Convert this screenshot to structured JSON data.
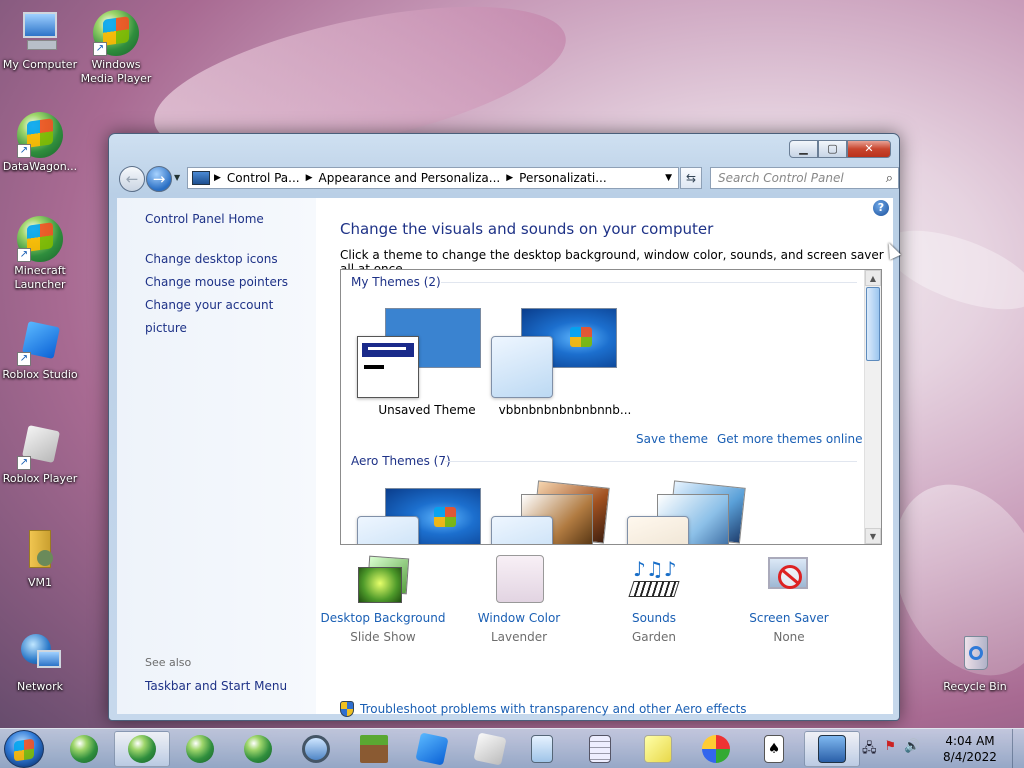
{
  "desktop": {
    "icons": [
      {
        "label": "My Computer",
        "icon": "computer-icon"
      },
      {
        "label": "Windows Media Player",
        "icon": "media-player-icon"
      },
      {
        "label": "DataWagon...",
        "icon": "shortcut-orb-icon"
      },
      {
        "label": "Minecraft Launcher",
        "icon": "shortcut-orb-icon"
      },
      {
        "label": "Roblox Studio",
        "icon": "roblox-studio-icon"
      },
      {
        "label": "Roblox Player",
        "icon": "roblox-player-icon"
      },
      {
        "label": "VM1",
        "icon": "user-folder-icon"
      },
      {
        "label": "Network",
        "icon": "network-icon"
      },
      {
        "label": "Recycle Bin",
        "icon": "recycle-bin-icon"
      }
    ]
  },
  "window": {
    "caption_buttons": {
      "minimize": "▁",
      "maximize": "▢",
      "close": "✕"
    },
    "breadcrumb": [
      "Control Pa...",
      "Appearance and Personaliza...",
      "Personalizati..."
    ],
    "search_placeholder": "Search Control Panel",
    "left_pane": {
      "home": "Control Panel Home",
      "tasks": [
        "Change desktop icons",
        "Change mouse pointers",
        "Change your account picture"
      ],
      "see_also": "See also",
      "see_also_links": [
        "Taskbar and Start Menu"
      ]
    },
    "content": {
      "title": "Change the visuals and sounds on your computer",
      "subtitle": "Click a theme to change the desktop background, window color, sounds, and screen saver all at once.",
      "my_themes_label": "My Themes (2)",
      "my_themes": [
        {
          "name": "Unsaved Theme"
        },
        {
          "name": "vbbnbnbnbnbnbnnb..."
        }
      ],
      "save_theme": "Save theme",
      "get_more": "Get more themes online",
      "aero_themes_label": "Aero Themes (7)",
      "bottom_items": [
        {
          "label": "Desktop Background",
          "value": "Slide Show",
          "icon": "desktop-background-icon"
        },
        {
          "label": "Window Color",
          "value": "Lavender",
          "icon": "window-color-icon"
        },
        {
          "label": "Sounds",
          "value": "Garden",
          "icon": "sounds-icon"
        },
        {
          "label": "Screen Saver",
          "value": "None",
          "icon": "screen-saver-icon"
        }
      ],
      "troubleshoot": "Troubleshoot problems with transparency and other Aero effects"
    }
  },
  "taskbar": {
    "time": "4:04 AM",
    "date": "8/4/2022"
  },
  "colors": {
    "link": "#1a5fb4",
    "heading": "#1e3287",
    "accent": "#2f7ad8"
  }
}
